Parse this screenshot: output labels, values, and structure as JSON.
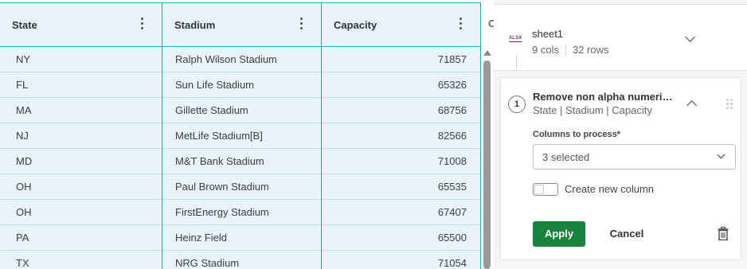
{
  "grid": {
    "columns": [
      {
        "label": "State"
      },
      {
        "label": "Stadium"
      },
      {
        "label": "Capacity"
      }
    ],
    "next_column_partial": "C",
    "rows": [
      {
        "state": "NY",
        "stadium": "Ralph Wilson Stadium",
        "capacity": "71857"
      },
      {
        "state": "FL",
        "stadium": "Sun Life Stadium",
        "capacity": "65326"
      },
      {
        "state": "MA",
        "stadium": "Gillette Stadium",
        "capacity": "68756"
      },
      {
        "state": "NJ",
        "stadium": "MetLife Stadium[B]",
        "capacity": "82566"
      },
      {
        "state": "MD",
        "stadium": "M&T Bank Stadium",
        "capacity": "71008"
      },
      {
        "state": "OH",
        "stadium": "Paul Brown Stadium",
        "capacity": "65535"
      },
      {
        "state": "OH",
        "stadium": "FirstEnergy Stadium",
        "capacity": "67407"
      },
      {
        "state": "PA",
        "stadium": "Heinz Field",
        "capacity": "65500"
      },
      {
        "state": "TX",
        "stadium": "NRG Stadium",
        "capacity": "71054"
      }
    ]
  },
  "file": {
    "icon_text": "XLSX",
    "name": "sheet1",
    "cols": "9 cols",
    "rows": "32 rows"
  },
  "step": {
    "number": "1",
    "title": "Remove non alpha numeri…",
    "columns_summary": "State | Stadium | Capacity",
    "columns_label": "Columns to process*",
    "columns_value": "3 selected",
    "create_new_column_label": "Create new column",
    "create_new_column_on": false,
    "apply_label": "Apply",
    "cancel_label": "Cancel"
  },
  "colors": {
    "accent": "#29a6b7",
    "header_bg": "#e8f3fb",
    "apply_green": "#19833e",
    "xlsx_purple": "#7a2d76"
  }
}
